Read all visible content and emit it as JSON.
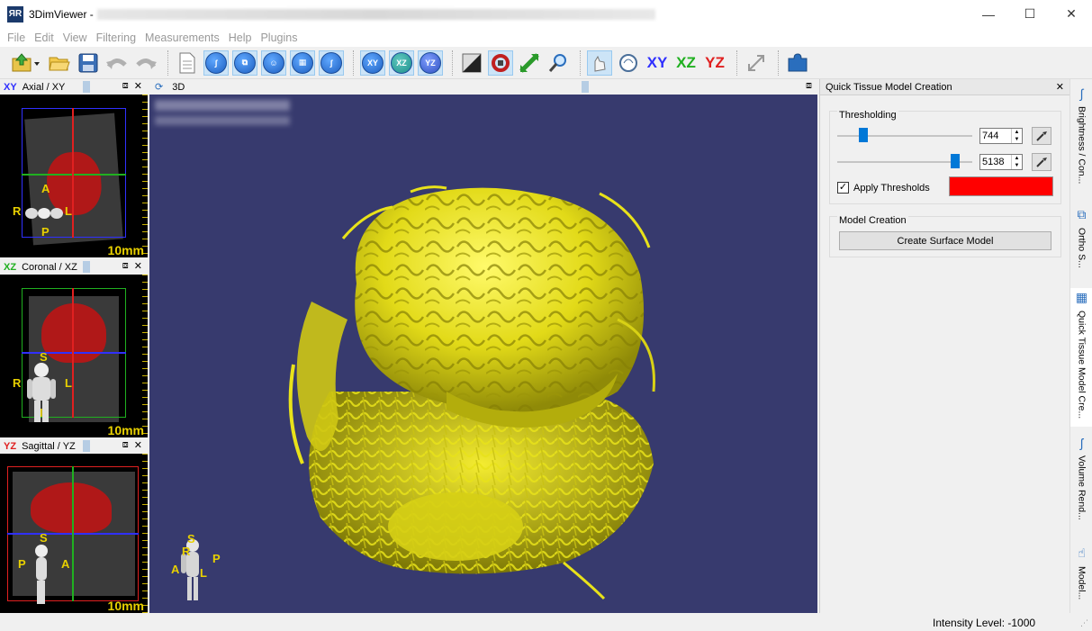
{
  "window": {
    "title": "3DimViewer -",
    "minimize": "—",
    "maximize": "☐",
    "close": "✕"
  },
  "menu": [
    "File",
    "Edit",
    "View",
    "Filtering",
    "Measurements",
    "Help",
    "Plugins"
  ],
  "toolbar": {
    "xy": "XY",
    "xz": "XZ",
    "yz": "YZ",
    "circle_xy": "XY",
    "circle_xz": "XZ",
    "circle_yz": "YZ"
  },
  "panels": {
    "axial": {
      "label": "XY",
      "title": "Axial / XY",
      "scale": "10mm",
      "dir_a": "A",
      "dir_p": "P",
      "dir_r": "R",
      "dir_l": "L"
    },
    "coronal": {
      "label": "XZ",
      "title": "Coronal / XZ",
      "scale": "10mm",
      "dir_s": "S",
      "dir_i": "I",
      "dir_r": "R",
      "dir_l": "L"
    },
    "sagittal": {
      "label": "YZ",
      "title": "Sagittal / YZ",
      "scale": "10mm",
      "dir_s": "S",
      "dir_p": "P",
      "dir_a": "A"
    }
  },
  "view3d": {
    "title": "3D",
    "dir_s": "S",
    "dir_p": "P",
    "dir_a": "A",
    "dir_l": "L",
    "dir_r": "R"
  },
  "right_panel": {
    "title": "Quick Tissue Model Creation",
    "thresholding": {
      "group_title": "Thresholding",
      "low_value": "744",
      "high_value": "5138",
      "low_level": 0.17,
      "high_level": 0.9,
      "apply_label": "Apply Thresholds",
      "apply_checked": true,
      "color": "#ff0000"
    },
    "model_creation": {
      "group_title": "Model Creation",
      "button": "Create Surface Model"
    }
  },
  "side_tabs": [
    "Brightness / Con...",
    "Ortho S...",
    "Quick Tissue Model Cre...",
    "Volume Rend...",
    "Model..."
  ],
  "status": {
    "intensity": "Intensity Level: -1000"
  },
  "colors": {
    "model": "#e8e21a",
    "background_3d": "#373a6e",
    "xy": "#3030ff",
    "xz": "#20b020",
    "yz": "#e02020"
  }
}
